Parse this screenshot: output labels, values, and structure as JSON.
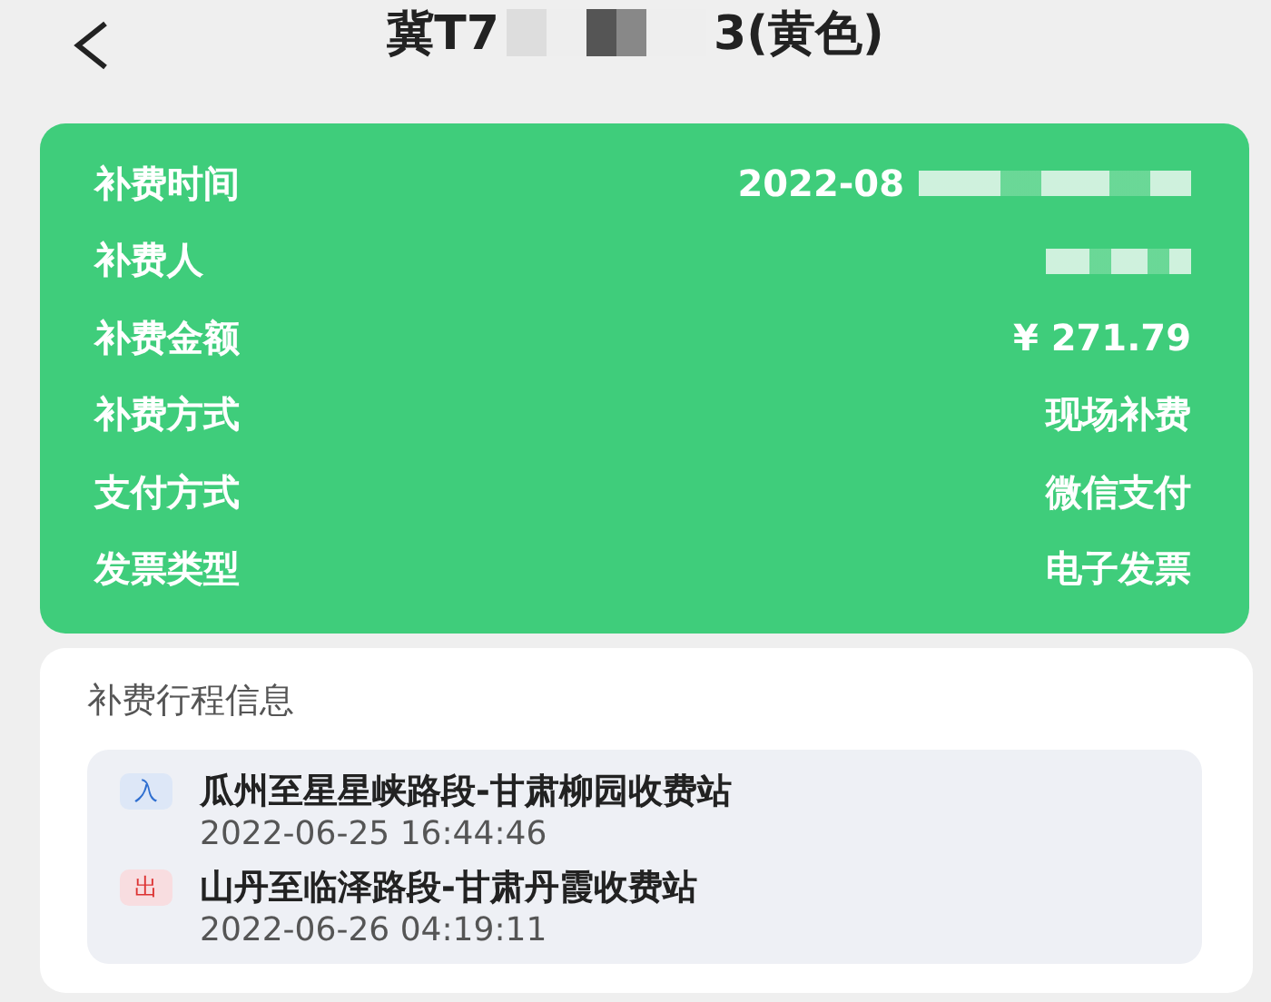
{
  "header": {
    "title_start": "冀T7",
    "title_end": "3(黄色)",
    "redacted": true
  },
  "details": [
    {
      "label": "补费时间",
      "value": "2022-08",
      "redacted": true
    },
    {
      "label": "补费人",
      "redacted": true
    },
    {
      "label": "补费金额",
      "value": "¥ 271.79"
    },
    {
      "label": "补费方式",
      "value": "现场补费"
    },
    {
      "label": "支付方式",
      "value": "微信支付"
    },
    {
      "label": "发票类型",
      "value": "电子发票"
    }
  ],
  "trip": {
    "title": "补费行程信息",
    "stops": [
      {
        "kind": "entry",
        "badge": "入",
        "station": "瓜州至星星峡路段-甘肃柳园收费站",
        "time": "2022-06-25 16:44:46"
      },
      {
        "kind": "exit",
        "badge": "出",
        "station": "山丹至临泽路段-甘肃丹霞收费站",
        "time": "2022-06-26 04:19:11"
      }
    ]
  }
}
